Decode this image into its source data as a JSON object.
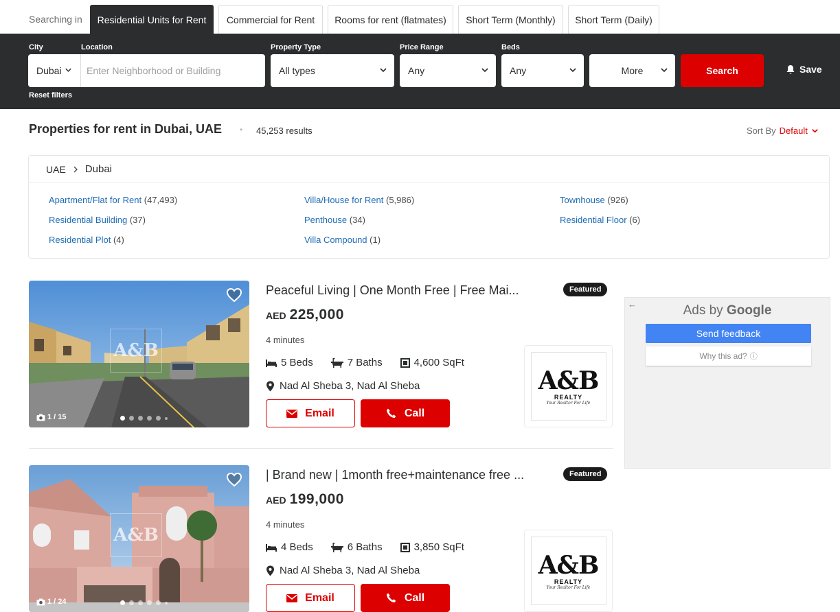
{
  "tabs": {
    "searching_in": "Searching in",
    "items": [
      {
        "label": "Residential Units for Rent",
        "active": true
      },
      {
        "label": "Commercial for Rent",
        "active": false
      },
      {
        "label": "Rooms for rent (flatmates)",
        "active": false
      },
      {
        "label": "Short Term (Monthly)",
        "active": false
      },
      {
        "label": "Short Term (Daily)",
        "active": false
      }
    ]
  },
  "filters": {
    "city_label": "City",
    "city_value": "Dubai",
    "location_label": "Location",
    "location_placeholder": "Enter Neighborhood or Building",
    "property_type_label": "Property Type",
    "property_type_value": "All types",
    "price_range_label": "Price Range",
    "price_range_value": "Any",
    "beds_label": "Beds",
    "beds_value": "Any",
    "more_label": "More",
    "search_label": "Search",
    "save_label": "Save",
    "reset_label": "Reset filters"
  },
  "heading": {
    "title": "Properties for rent in Dubai, UAE",
    "results": "45,253 results",
    "sort_label": "Sort By",
    "sort_value": "Default"
  },
  "breadcrumb": {
    "root": "UAE",
    "current": "Dubai"
  },
  "categories": [
    {
      "label": "Apartment/Flat for Rent",
      "count": "(47,493)"
    },
    {
      "label": "Villa/House for Rent",
      "count": "(5,986)"
    },
    {
      "label": "Townhouse",
      "count": "(926)"
    },
    {
      "label": "Residential Building",
      "count": "(37)"
    },
    {
      "label": "Penthouse",
      "count": "(34)"
    },
    {
      "label": "Residential Floor",
      "count": "(6)"
    },
    {
      "label": "Residential Plot",
      "count": "(4)"
    },
    {
      "label": "Villa Compound",
      "count": "(1)"
    }
  ],
  "listings": [
    {
      "title": "Peaceful Living | One Month Free | Free Mai...",
      "badge": "Featured",
      "currency": "AED",
      "price": "225,000",
      "duration": "4 minutes",
      "beds": "5 Beds",
      "baths": "7 Baths",
      "area": "4,600 SqFt",
      "location": "Nad Al Sheba 3, Nad Al Sheba",
      "photo_counter": "1 / 15",
      "email_label": "Email",
      "call_label": "Call",
      "agency_logo": {
        "main": "A&B",
        "sub": "REALTY",
        "tagline": "Your Realtor For Life"
      }
    },
    {
      "title": "| Brand new | 1month free+maintenance free ...",
      "badge": "Featured",
      "currency": "AED",
      "price": "199,000",
      "duration": "4 minutes",
      "beds": "4 Beds",
      "baths": "6 Baths",
      "area": "3,850 SqFt",
      "location": "Nad Al Sheba 3, Nad Al Sheba",
      "photo_counter": "1 / 24",
      "email_label": "Email",
      "call_label": "Call",
      "agency_logo": {
        "main": "A&B",
        "sub": "REALTY",
        "tagline": "Your Realtor For Life"
      }
    }
  ],
  "ad": {
    "ads_by": "Ads by",
    "google": "Google",
    "feedback_label": "Send feedback",
    "why_label": "Why this ad?"
  },
  "colors": {
    "accent": "#dd0000",
    "dark": "#2b2d2e",
    "link": "#1f6cb4",
    "google_blue": "#4284f4"
  }
}
